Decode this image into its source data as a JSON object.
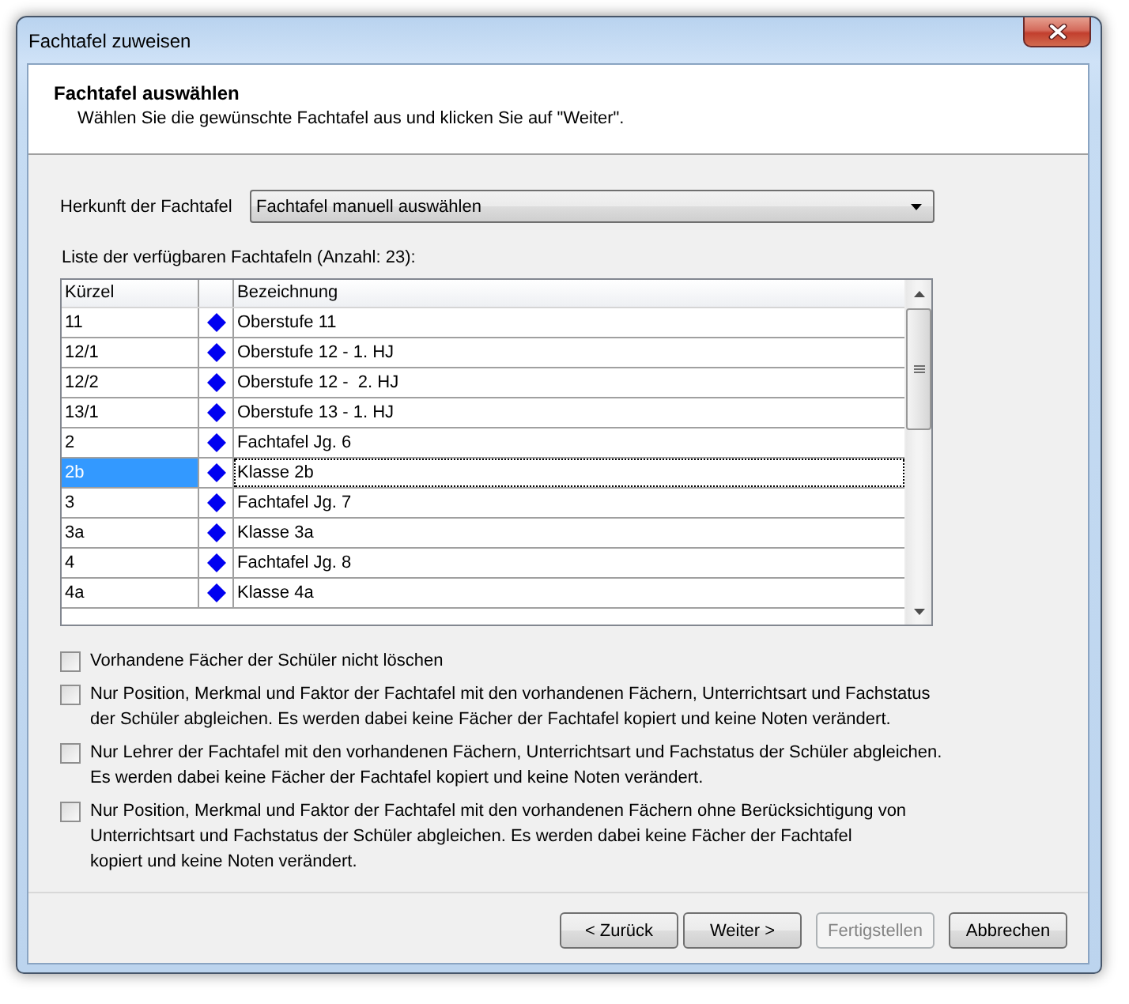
{
  "window": {
    "title": "Fachtafel zuweisen"
  },
  "header": {
    "title": "Fachtafel auswählen",
    "subtitle": "Wählen Sie die gewünschte Fachtafel aus und klicken Sie auf \"Weiter\"."
  },
  "origin": {
    "label": "Herkunft der Fachtafel",
    "value": "Fachtafel manuell auswählen"
  },
  "list": {
    "label": "Liste der verfügbaren Fachtafeln (Anzahl: 23):",
    "columns": [
      "Kürzel",
      "Bezeichnung"
    ],
    "rows": [
      {
        "code": "11",
        "name": "Oberstufe 11",
        "selected": false
      },
      {
        "code": "12/1",
        "name": "Oberstufe 12 - 1. HJ",
        "selected": false
      },
      {
        "code": "12/2",
        "name": "Oberstufe 12 -  2. HJ",
        "selected": false
      },
      {
        "code": "13/1",
        "name": "Oberstufe 13 - 1. HJ",
        "selected": false
      },
      {
        "code": "2",
        "name": "Fachtafel Jg. 6",
        "selected": false
      },
      {
        "code": "2b",
        "name": "Klasse 2b",
        "selected": true
      },
      {
        "code": "3",
        "name": "Fachtafel Jg. 7",
        "selected": false
      },
      {
        "code": "3a",
        "name": "Klasse 3a",
        "selected": false
      },
      {
        "code": "4",
        "name": "Fachtafel Jg. 8",
        "selected": false
      },
      {
        "code": "4a",
        "name": "Klasse 4a",
        "selected": false
      }
    ]
  },
  "options": [
    {
      "label": "Vorhandene Fächer der Schüler nicht löschen",
      "checked": false
    },
    {
      "label": "Nur Position, Merkmal und Faktor der Fachtafel mit den vorhandenen Fächern, Unterrichtsart und Fachstatus\nder Schüler abgleichen. Es werden dabei keine Fächer der Fachtafel kopiert und keine Noten verändert.",
      "checked": false
    },
    {
      "label": "Nur Lehrer der Fachtafel mit den vorhandenen Fächern, Unterrichtsart und Fachstatus der Schüler abgleichen.\nEs werden dabei keine Fächer der Fachtafel kopiert und keine Noten verändert.",
      "checked": false
    },
    {
      "label": "Nur Position, Merkmal und Faktor der Fachtafel mit den vorhandenen Fächern ohne Berücksichtigung von\nUnterrichtsart und Fachstatus der Schüler abgleichen. Es werden dabei keine Fächer der Fachtafel\nkopiert und keine Noten verändert.",
      "checked": false
    }
  ],
  "buttons": [
    {
      "label": "< Zurück",
      "disabled": false
    },
    {
      "label": "Weiter >",
      "disabled": false
    },
    {
      "label": "Fertigstellen",
      "disabled": true
    },
    {
      "label": "Abbrechen",
      "disabled": false
    }
  ]
}
